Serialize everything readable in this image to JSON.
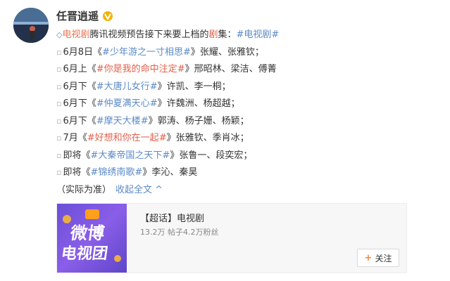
{
  "user": {
    "name": "任晋逍遥"
  },
  "post": {
    "intro": {
      "tag": "电视剧",
      "text1": "腾讯视频预告接下来要上档的",
      "red": "剧",
      "text2": "集：",
      "hashtag": "#电视剧#"
    },
    "items": [
      {
        "date": "6月8日",
        "open": "《",
        "hash1": "#",
        "title": "少年游之一寸相思",
        "hash2": "#",
        "close": "》",
        "cast": "张耀、张雅钦；",
        "red": false
      },
      {
        "date": "6月上",
        "open": "《",
        "hash1": "#",
        "title": "你是我的命中注定",
        "hash2": "#",
        "close": "》",
        "cast": "邢昭林、梁洁、傅菁",
        "red": true
      },
      {
        "date": "6月下",
        "open": "《",
        "hash1": "#",
        "title": "大唐儿女行",
        "hash2": "#",
        "close": "》",
        "cast": "许凯、李一桐；",
        "red": false
      },
      {
        "date": "6月下",
        "open": "《",
        "hash1": "#",
        "title": "仲夏满天心",
        "hash2": "#",
        "close": "》",
        "cast": "许魏洲、杨超越；",
        "red": false
      },
      {
        "date": "6月下",
        "open": "《",
        "hash1": "#",
        "title": "摩天大楼",
        "hash2": "#",
        "close": "》",
        "cast": "郭涛、杨子姗、杨颖；",
        "red": false
      },
      {
        "date": "7月",
        "open": "《",
        "hash1": "#",
        "title": "好想和你在一起",
        "hash2": "#",
        "close": "》",
        "cast": "张雅钦、季肖冰；",
        "red": true
      },
      {
        "date": "即将",
        "open": "《",
        "hash1": "#",
        "title": "大秦帝国之天下",
        "hash2": "#",
        "close": "》",
        "cast": "张鲁一、段奕宏；",
        "red": false
      },
      {
        "date": "即将",
        "open": "《",
        "hash1": "#",
        "title": "锦绣南歌",
        "hash2": "#",
        "close": "》",
        "cast": "李沁、秦昊",
        "red": false
      }
    ],
    "footer_note": "（实际为准）",
    "collapse_label": "收起全文"
  },
  "card": {
    "title": "【超话】电视剧",
    "stats": "13.2万 帖子4.2万粉丝",
    "image_text_top": "微博",
    "image_text_bottom": "电视团",
    "follow_label": "关注"
  },
  "colors": {
    "link": "#5c8ac7",
    "red": "#e0614b",
    "tag": "#eb7350"
  }
}
